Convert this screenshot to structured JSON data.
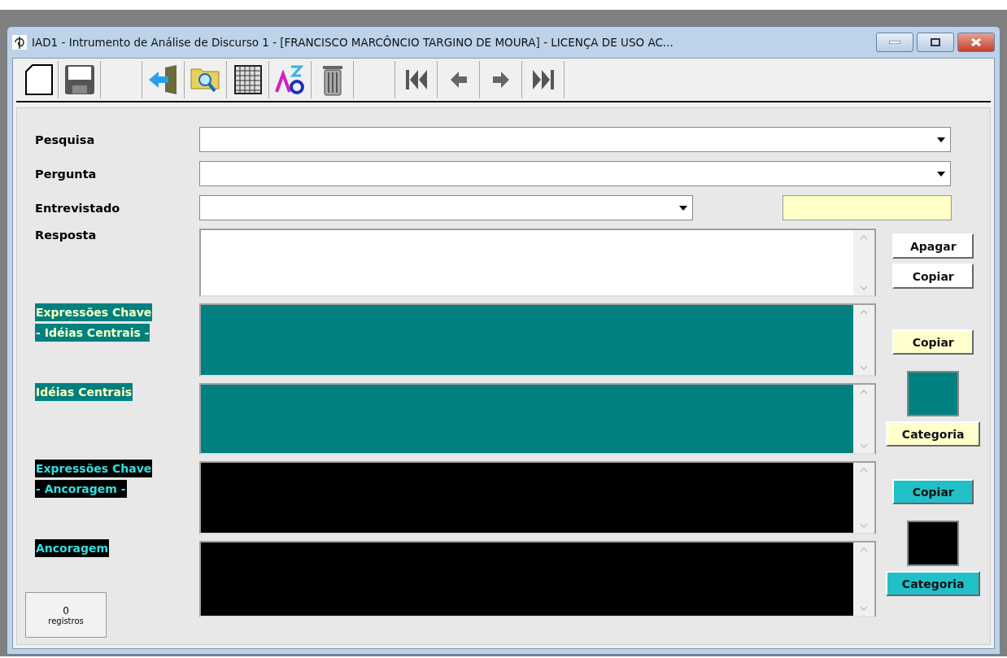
{
  "window": {
    "title": "IAD1 - Intrumento de Análise de Discurso 1  -  [FRANCISCO MARCÔNCIO TARGINO DE MOURA]  - LICENÇA DE USO AC..."
  },
  "fields": [
    {
      "label": "Pesquisa",
      "kind": "wide"
    },
    {
      "label": "Pergunta",
      "kind": "wide"
    },
    {
      "label": "Entrevistado",
      "kind": "narrow"
    }
  ],
  "resposta": {
    "label": "Resposta",
    "buttons": [
      "Apagar",
      "Copiar"
    ]
  },
  "sections": [
    {
      "kind": "teal",
      "key_label": [
        "Expressões Chave",
        "- Idéias Centrais -"
      ],
      "idea_label": "Idéias Centrais",
      "copy_button": "Copiar",
      "category_button": "Categoria"
    },
    {
      "kind": "black",
      "key_label": [
        "Expressões Chave",
        "- Ancoragem -"
      ],
      "idea_label": "Ancoragem",
      "copy_button": "Copiar",
      "category_button": "Categoria"
    }
  ],
  "records": {
    "count": "0",
    "label": "registros"
  }
}
